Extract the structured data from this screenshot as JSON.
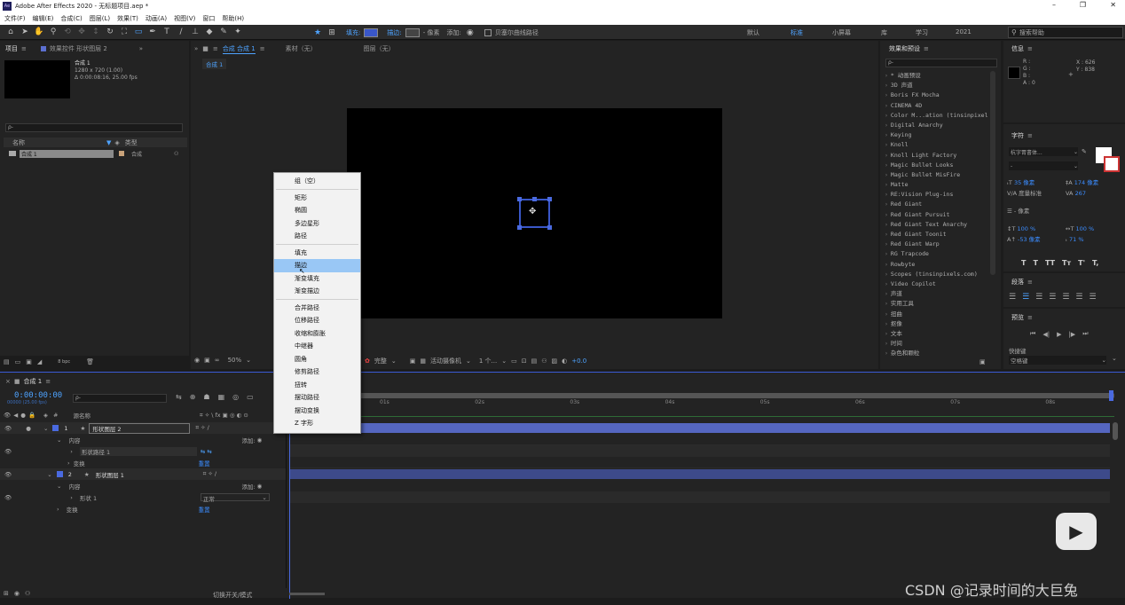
{
  "window": {
    "title": "Adobe After Effects 2020 - 无标题项目.aep *",
    "minimize": "–",
    "maximize": "❐",
    "close": "✕"
  },
  "menu": [
    "文件(F)",
    "编辑(E)",
    "合成(C)",
    "图层(L)",
    "效果(T)",
    "动画(A)",
    "视图(V)",
    "窗口",
    "帮助(H)"
  ],
  "toolbar": {
    "fill_label": "填充:",
    "stroke_label": "描边:",
    "stroke_width": "- 像素",
    "add_label": "添加:",
    "bezier_label": "贝塞尔曲线路径",
    "workspaces": [
      "默认",
      "标准",
      "小屏幕",
      "库",
      "学习",
      "2021"
    ],
    "active_workspace": "标准",
    "search_help": "搜索帮助",
    "colors": {
      "fill": "#3a57c9",
      "accent": "#4ea3ff",
      "selected_menu": "#99c7f5"
    }
  },
  "project_panel": {
    "tabs": [
      "项目",
      "效果控件 形状图层 2"
    ],
    "comp_name": "合成 1",
    "comp_size": "1280 x 720 (1.00)",
    "comp_duration": "Δ 0:00:08:16, 25.00 fps",
    "search_placeholder": "ρ-",
    "col_name": "名称",
    "col_type": "类型",
    "item_name": "合成 1",
    "item_type": "合成",
    "bpc": "8 bpc"
  },
  "comp_panel": {
    "tab": "合成 合成 1",
    "footage_tab": "素材（无）",
    "layer_tab": "图层（无）",
    "breadcrumb": "合成 1",
    "zoom": "50%",
    "resolution": "完整",
    "camera": "活动摄像机",
    "views": "1 个...",
    "exposure": "+0.0"
  },
  "context_menu": {
    "groups": [
      [
        "组（空）"
      ],
      [
        "矩形",
        "椭圆",
        "多边星形",
        "路径"
      ],
      [
        "填充",
        "描边",
        "渐变填充",
        "渐变描边"
      ],
      [
        "合并路径",
        "位移路径",
        "收缩和膨胀",
        "中继器",
        "圆角",
        "修剪路径",
        "扭转",
        "摆动路径",
        "摆动变换",
        "Z 字形"
      ]
    ],
    "selected": "描边"
  },
  "effects_panel": {
    "title": "效果和预设",
    "search_placeholder": "ρ-",
    "items": [
      "* 动画预设",
      "3D 声道",
      "Boris FX Mocha",
      "CINEMA 4D",
      "Color M...ation (tinsinpixel",
      "Digital Anarchy",
      "Keying",
      "Knoll",
      "Knoll Light Factory",
      "Magic Bullet Looks",
      "Magic Bullet MisFire",
      "Matte",
      "RE:Vision Plug-ins",
      "Red Giant",
      "Red Giant Pursuit",
      "Red Giant Text Anarchy",
      "Red Giant Toonit",
      "Red Giant Warp",
      "RG Trapcode",
      "Rowbyte",
      "Scopes (tinsinpixels.com)",
      "Video Copilot",
      "声道",
      "实用工具",
      "扭曲",
      "抠像",
      "文本",
      "时间",
      "杂色和颗粒"
    ]
  },
  "info_panel": {
    "title": "信息",
    "r": "R :",
    "g": "G :",
    "b": "B :",
    "a": "A : 0",
    "x": "X : 626",
    "y": "Y : 838"
  },
  "character_panel": {
    "title": "字符",
    "font": "杭字胃書体...",
    "style": "-",
    "size": "35 像素",
    "leading": "174 像素",
    "tracking": "267",
    "kerning_label": "度量标准",
    "stroke": "- 像素",
    "vscale": "100 %",
    "hscale": "100 %",
    "baseline": "-53 像素",
    "tsume": "71 %",
    "styles": [
      "T",
      "T",
      "TT",
      "Tт",
      "T'",
      "T,"
    ]
  },
  "paragraph_panel": {
    "title": "段落"
  },
  "preview_panel": {
    "title": "预览",
    "shortcut_label": "快捷键",
    "shortcut_value": "空格键"
  },
  "timeline": {
    "tab": "合成 1",
    "timecode": "0:00:00:00",
    "frames": "00000 (25.00 fps)",
    "col_source": "源名称",
    "ruler": [
      "01s",
      "02s",
      "03s",
      "04s",
      "05s",
      "06s",
      "07s",
      "08s"
    ],
    "switches_label": "切换开关/模式",
    "layers": [
      {
        "num": "1",
        "name": "形状图层 2",
        "contents": "内容",
        "add": "添加:",
        "group": "形状路径 1",
        "transform": "变换",
        "transform_value": "重置"
      },
      {
        "num": "2",
        "name": "形状图层 1",
        "contents": "内容",
        "add": "添加:",
        "group": "形状 1",
        "mode": "正常",
        "transform": "变换",
        "transform_value": "重置"
      }
    ]
  },
  "watermark": "CSDN @记录时间的大巨兔"
}
